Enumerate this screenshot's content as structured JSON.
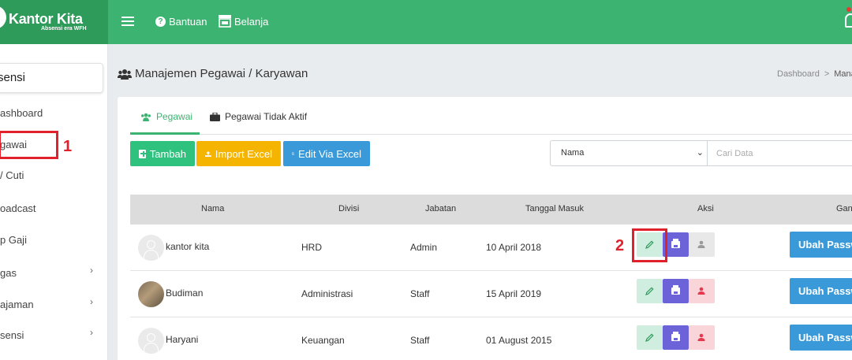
{
  "brand": {
    "name": "Kantor Kita",
    "tagline": "Absensi era WFH"
  },
  "topbar": {
    "help_label": "Bantuan",
    "shop_label": "Belanja"
  },
  "sidebar": {
    "header": "sensi",
    "items": [
      {
        "label": "ashboard",
        "has_submenu": false
      },
      {
        "label": "gawai",
        "has_submenu": false
      },
      {
        "label": "/ Cuti",
        "has_submenu": false
      },
      {
        "label": "oadcast",
        "has_submenu": false
      },
      {
        "label": "p Gaji",
        "has_submenu": false
      },
      {
        "label": "gas",
        "has_submenu": true
      },
      {
        "label": "ajaman",
        "has_submenu": true
      },
      {
        "label": "sensi",
        "has_submenu": true
      }
    ]
  },
  "annotations": {
    "step1": "1",
    "step2": "2",
    "highlight_color": "#e0212b"
  },
  "page": {
    "title": "Manajemen Pegawai / Karyawan"
  },
  "breadcrumb": {
    "home": "Dashboard",
    "separator": ">",
    "current": "Mana"
  },
  "tabs": [
    {
      "label": "Pegawai",
      "active": true
    },
    {
      "label": "Pegawai Tidak Aktif",
      "active": false
    }
  ],
  "toolbar": {
    "add_label": "Tambah",
    "import_label": "Import Excel",
    "edit_excel_label": "Edit Via Excel"
  },
  "filter": {
    "selected": "Nama",
    "search_placeholder": "Cari Data"
  },
  "table": {
    "headers": {
      "nama": "Nama",
      "divisi": "Divisi",
      "jabatan": "Jabatan",
      "tanggal": "Tanggal Masuk",
      "aksi": "Aksi",
      "ganti": "Gan"
    },
    "rows": [
      {
        "nama": "kantor kita",
        "divisi": "HRD",
        "jabatan": "Admin",
        "tanggal": "10 April 2018",
        "avatar": "placeholder",
        "delete_disabled": true
      },
      {
        "nama": "Budiman",
        "divisi": "Administrasi",
        "jabatan": "Staff",
        "tanggal": "15 April 2019",
        "avatar": "photo",
        "delete_disabled": false
      },
      {
        "nama": "Haryani",
        "divisi": "Keuangan",
        "jabatan": "Staff",
        "tanggal": "01 August 2015",
        "avatar": "placeholder",
        "delete_disabled": false
      }
    ],
    "change_password_label": "Ubah Passw"
  },
  "colors": {
    "primary_green": "#3cb371",
    "brand_green": "#2e9b5b",
    "add_button": "#2ec27e",
    "import_button": "#f5b400",
    "info_blue": "#3a9ad9",
    "print_purple": "#6c63d8"
  }
}
